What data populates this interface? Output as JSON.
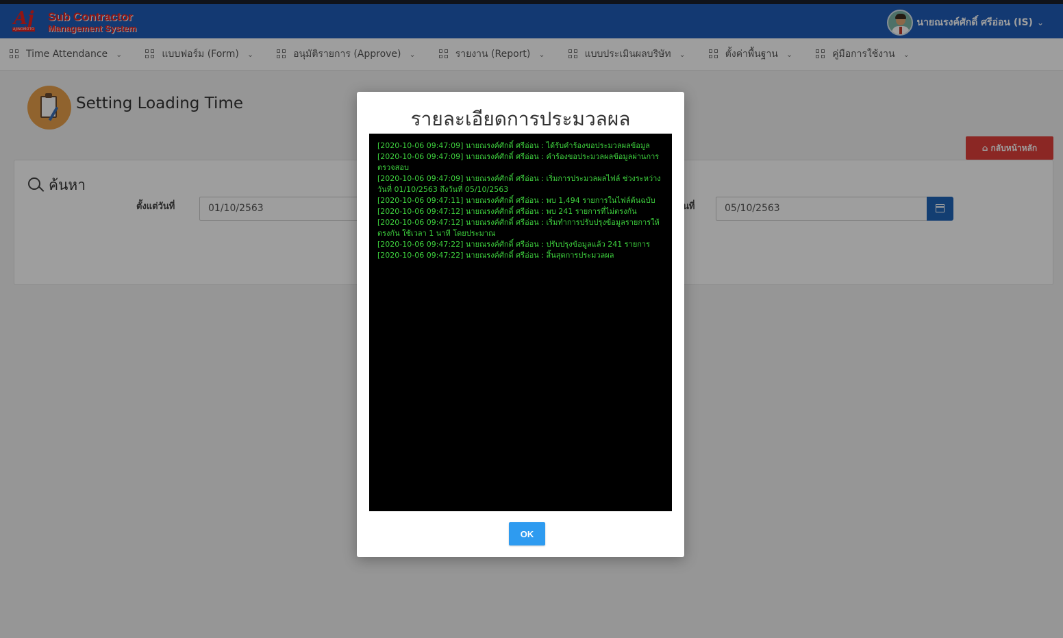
{
  "header": {
    "logo_text": "Aj",
    "logo_sub": "AJINOMOTO",
    "system_name_line1": "Sub Contractor",
    "system_name_line2": "Management System",
    "user_name": "นายณรงค์ศักดิ์ ศรีอ่อน (IS)",
    "user_caret": "⌄",
    "brand_color": "#1f5cb8"
  },
  "nav": {
    "items": [
      {
        "label": "Time Attendance"
      },
      {
        "label": "แบบฟอร์ม (Form)"
      },
      {
        "label": "อนุมัติรายการ (Approve)"
      },
      {
        "label": "รายงาน (Report)"
      },
      {
        "label": "แบบประเมินผลบริษัท"
      },
      {
        "label": "ตั้งค่าพื้นฐาน"
      },
      {
        "label": "คู่มือการใช้งาน"
      }
    ],
    "chevron": "⌄"
  },
  "page": {
    "title": "Setting Loading Time",
    "home_button_icon": "⌂",
    "home_button_label": "กลับหน้าหลัก"
  },
  "search": {
    "heading": "ค้นหา",
    "from_label": "ตั้งแต่วันที่",
    "from_value": "01/10/2563",
    "to_label": "นที่",
    "to_value": "05/10/2563"
  },
  "modal": {
    "title": "รายละเอียดการประมวลผล",
    "log_lines": [
      "[2020-10-06 09:47:09] นายณรงค์ศักดิ์ ศรีอ่อน : ได้รับคำร้องขอประมวลผลข้อมูล",
      "[2020-10-06 09:47:09] นายณรงค์ศักดิ์ ศรีอ่อน : คำร้องขอประมวลผลข้อมูลผ่านการตรวจสอบ",
      "[2020-10-06 09:47:09] นายณรงค์ศักดิ์ ศรีอ่อน : เริ่มการประมวลผลไฟล์ ช่วงระหว่างวันที่ 01/10/2563 ถึงวันที่ 05/10/2563",
      "[2020-10-06 09:47:11] นายณรงค์ศักดิ์ ศรีอ่อน :  พบ 1,494 รายการในไฟล์ต้นฉบับ",
      "[2020-10-06 09:47:12] นายณรงค์ศักดิ์ ศรีอ่อน :  พบ 241 รายการที่ไม่ตรงกัน",
      "[2020-10-06 09:47:12] นายณรงค์ศักดิ์ ศรีอ่อน :  เริ่มทำการปรับปรุงข้อมูลรายการให้ตรงกัน ใช้เวลา 1 นาที โดยประมาณ",
      "[2020-10-06 09:47:22] นายณรงค์ศักดิ์ ศรีอ่อน :  ปรับปรุงข้อมูลแล้ว 241 รายการ",
      "[2020-10-06 09:47:22] นายณรงค์ศักดิ์ ศรีอ่อน : สิ้นสุดการประมวลผล"
    ],
    "ok_label": "OK",
    "log_color": "#3ed23e"
  }
}
